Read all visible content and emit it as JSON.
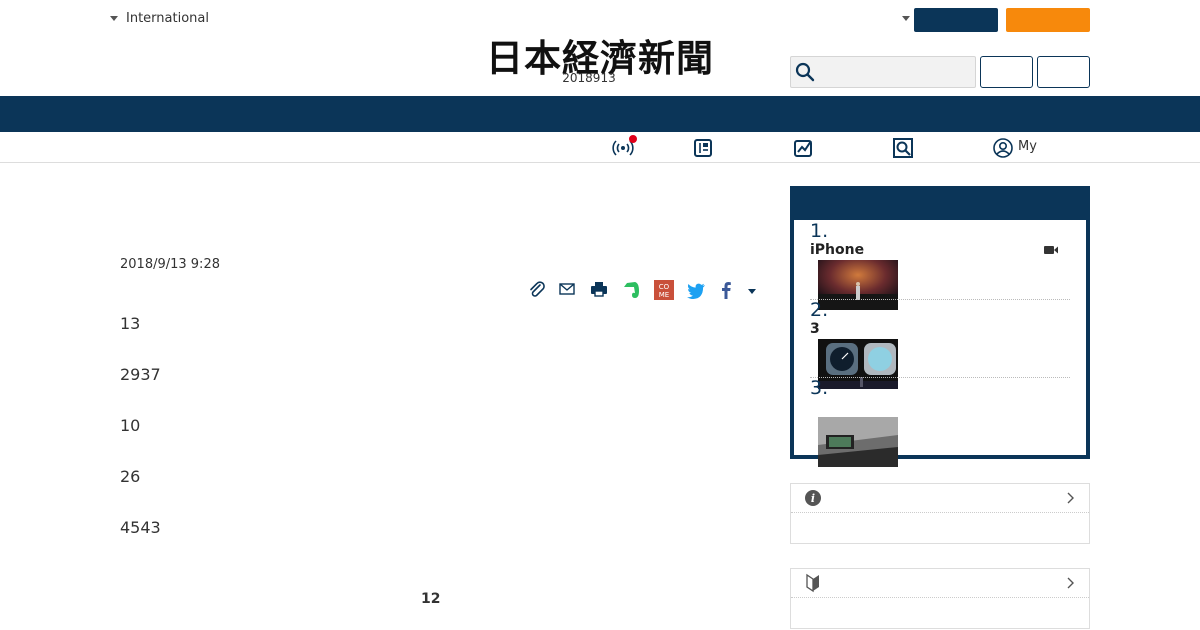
{
  "header": {
    "lang_selector": "International",
    "logo": "日本経濟新聞",
    "date": "2018913",
    "my_label": "My"
  },
  "article": {
    "pubdate": "2018/9/13 9:28",
    "paragraphs": [
      "13",
      "2937",
      "10",
      "26",
      "4543"
    ],
    "page_number": "12"
  },
  "ranking": {
    "items": [
      {
        "num": "1.",
        "title": "iPhone",
        "has_video": true
      },
      {
        "num": "2.",
        "title": "3",
        "has_video": false
      },
      {
        "num": "3.",
        "title": "",
        "has_video": false
      }
    ]
  },
  "side_modules": [
    {
      "icon": "info-icon"
    },
    {
      "icon": "beginner-icon"
    }
  ],
  "colors": {
    "navy": "#0b3558",
    "orange": "#f7890c",
    "notification": "#e0001a",
    "evernote": "#2dbe60",
    "twitter": "#1da1f2",
    "facebook": "#3b5998"
  }
}
